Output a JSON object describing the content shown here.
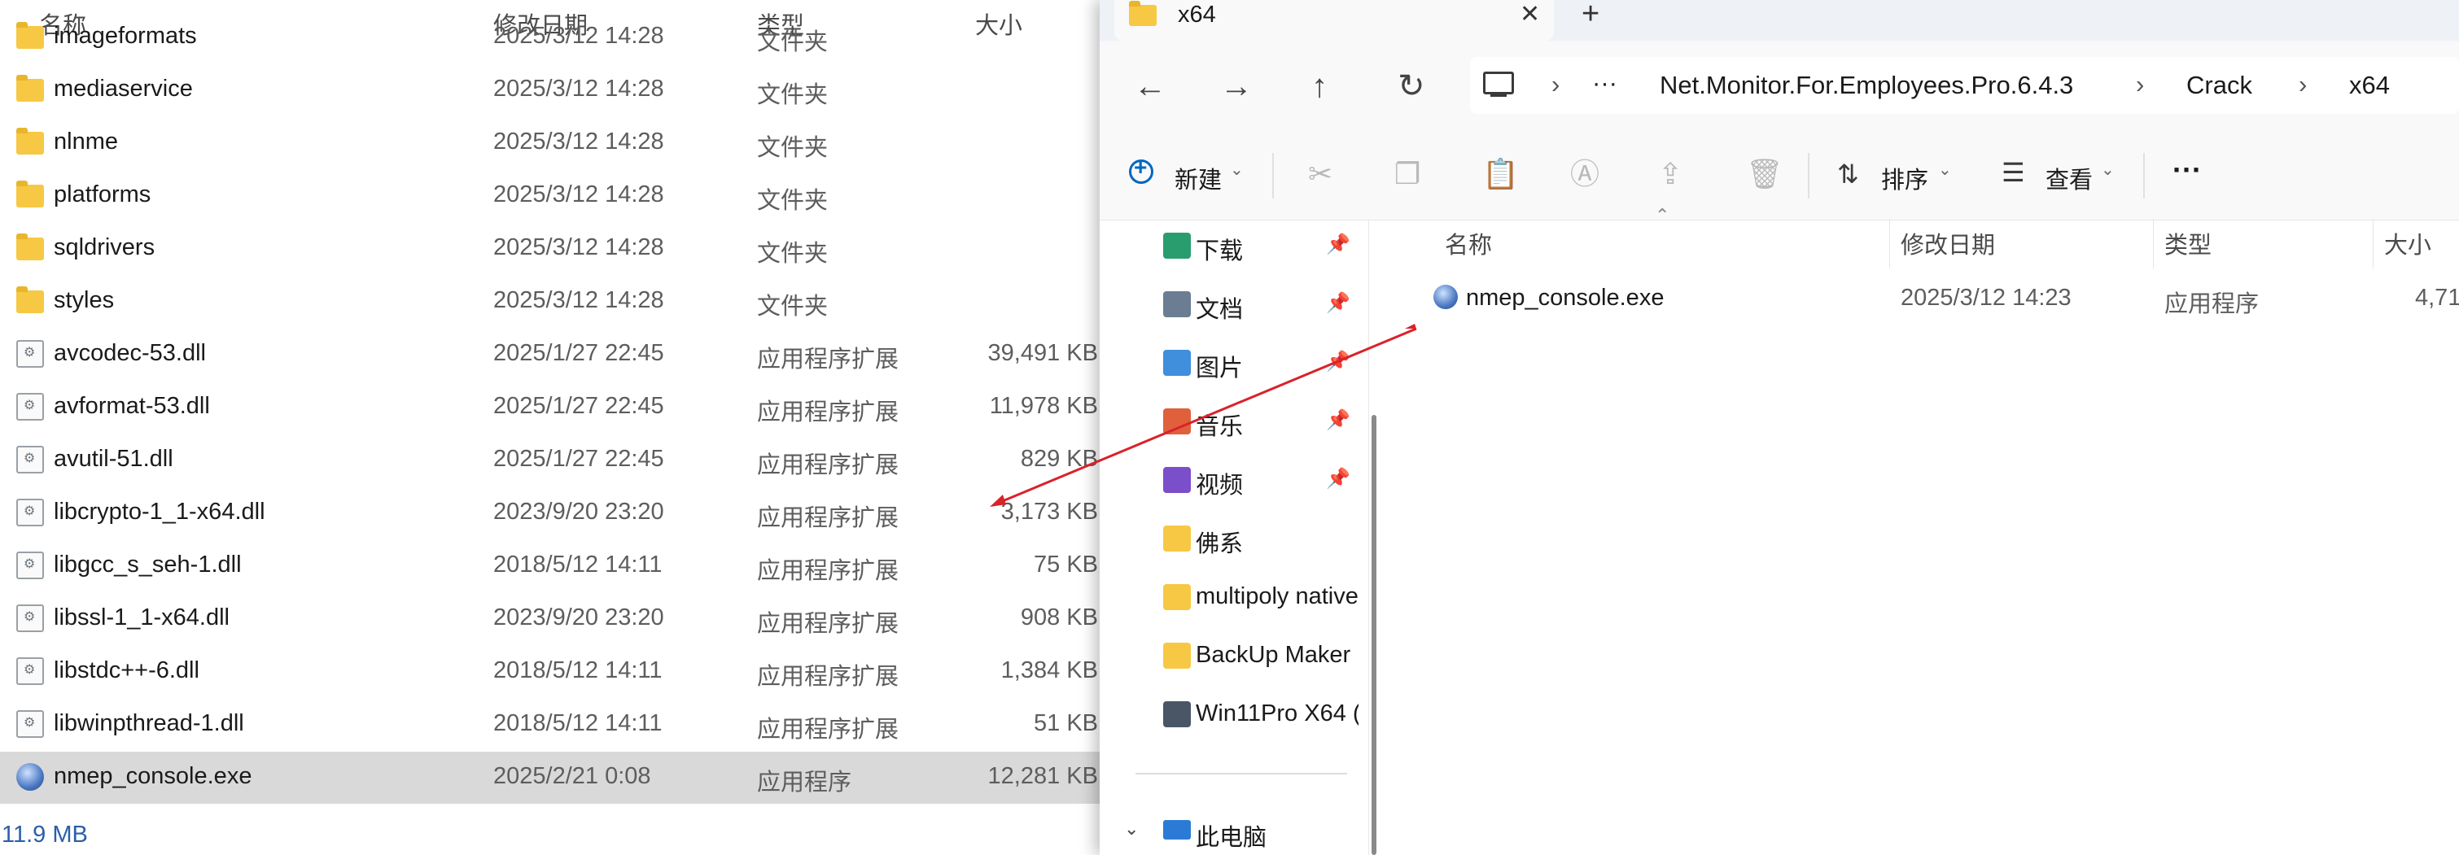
{
  "left_window": {
    "headers": {
      "name": "名称",
      "date": "修改日期",
      "type": "类型",
      "size": "大小"
    },
    "rows": [
      {
        "name": "imageformats",
        "date": "2025/3/12 14:28",
        "type": "文件夹",
        "size": "",
        "icon": "folder-icon"
      },
      {
        "name": "mediaservice",
        "date": "2025/3/12 14:28",
        "type": "文件夹",
        "size": "",
        "icon": "folder-icon"
      },
      {
        "name": "nlnme",
        "date": "2025/3/12 14:28",
        "type": "文件夹",
        "size": "",
        "icon": "folder-icon"
      },
      {
        "name": "platforms",
        "date": "2025/3/12 14:28",
        "type": "文件夹",
        "size": "",
        "icon": "folder-icon"
      },
      {
        "name": "sqldrivers",
        "date": "2025/3/12 14:28",
        "type": "文件夹",
        "size": "",
        "icon": "folder-icon"
      },
      {
        "name": "styles",
        "date": "2025/3/12 14:28",
        "type": "文件夹",
        "size": "",
        "icon": "folder-icon"
      },
      {
        "name": "avcodec-53.dll",
        "date": "2025/1/27 22:45",
        "type": "应用程序扩展",
        "size": "39,491 KB",
        "icon": "dll-file-icon"
      },
      {
        "name": "avformat-53.dll",
        "date": "2025/1/27 22:45",
        "type": "应用程序扩展",
        "size": "11,978 KB",
        "icon": "dll-file-icon"
      },
      {
        "name": "avutil-51.dll",
        "date": "2025/1/27 22:45",
        "type": "应用程序扩展",
        "size": "829 KB",
        "icon": "dll-file-icon"
      },
      {
        "name": "libcrypto-1_1-x64.dll",
        "date": "2023/9/20 23:20",
        "type": "应用程序扩展",
        "size": "3,173 KB",
        "icon": "dll-file-icon"
      },
      {
        "name": "libgcc_s_seh-1.dll",
        "date": "2018/5/12 14:11",
        "type": "应用程序扩展",
        "size": "75 KB",
        "icon": "dll-file-icon"
      },
      {
        "name": "libssl-1_1-x64.dll",
        "date": "2023/9/20 23:20",
        "type": "应用程序扩展",
        "size": "908 KB",
        "icon": "dll-file-icon"
      },
      {
        "name": "libstdc++-6.dll",
        "date": "2018/5/12 14:11",
        "type": "应用程序扩展",
        "size": "1,384 KB",
        "icon": "dll-file-icon"
      },
      {
        "name": "libwinpthread-1.dll",
        "date": "2018/5/12 14:11",
        "type": "应用程序扩展",
        "size": "51 KB",
        "icon": "dll-file-icon"
      },
      {
        "name": "nmep_console.exe",
        "date": "2025/2/21 0:08",
        "type": "应用程序",
        "size": "12,281 KB",
        "icon": "exe-globe-icon"
      }
    ],
    "selected_index": 14,
    "status": "11.9 MB"
  },
  "right_window": {
    "tab": {
      "title": "x64",
      "close": "✕",
      "new_tab": "+"
    },
    "nav": {
      "back": "←",
      "forward": "→",
      "up": "↑",
      "refresh": "↻",
      "more": "···",
      "breadcrumbs": [
        "Net.Monitor.For.Employees.Pro.6.4.3",
        "Crack",
        "x64"
      ]
    },
    "commands": {
      "new": "新建",
      "sort": "排序",
      "view": "查看",
      "more": "···"
    },
    "sidebar": [
      {
        "label": "下载",
        "icon": "download-folder-icon",
        "pinned": true
      },
      {
        "label": "文档",
        "icon": "documents-folder-icon",
        "pinned": true
      },
      {
        "label": "图片",
        "icon": "pictures-folder-icon",
        "pinned": true
      },
      {
        "label": "音乐",
        "icon": "music-folder-icon",
        "pinned": true
      },
      {
        "label": "视频",
        "icon": "videos-folder-icon",
        "pinned": true
      },
      {
        "label": "佛系",
        "icon": "folder-icon",
        "pinned": false
      },
      {
        "label": "multipoly native",
        "icon": "folder-icon",
        "pinned": false
      },
      {
        "label": "BackUp Maker",
        "icon": "folder-icon",
        "pinned": false
      },
      {
        "label": "Win11Pro X64 (",
        "icon": "network-drive-icon",
        "pinned": false
      }
    ],
    "this_pc": "此电脑",
    "headers": {
      "name": "名称",
      "date": "修改日期",
      "type": "类型",
      "size": "大小"
    },
    "files": [
      {
        "name": "nmep_console.exe",
        "date": "2025/3/12 14:23",
        "type": "应用程序",
        "size": "4,71"
      }
    ]
  },
  "colors": {
    "accent": "#0067c0",
    "annotation_arrow": "#d9222a",
    "folder": "#f7c843",
    "selected_row": "#d9d9d9"
  }
}
